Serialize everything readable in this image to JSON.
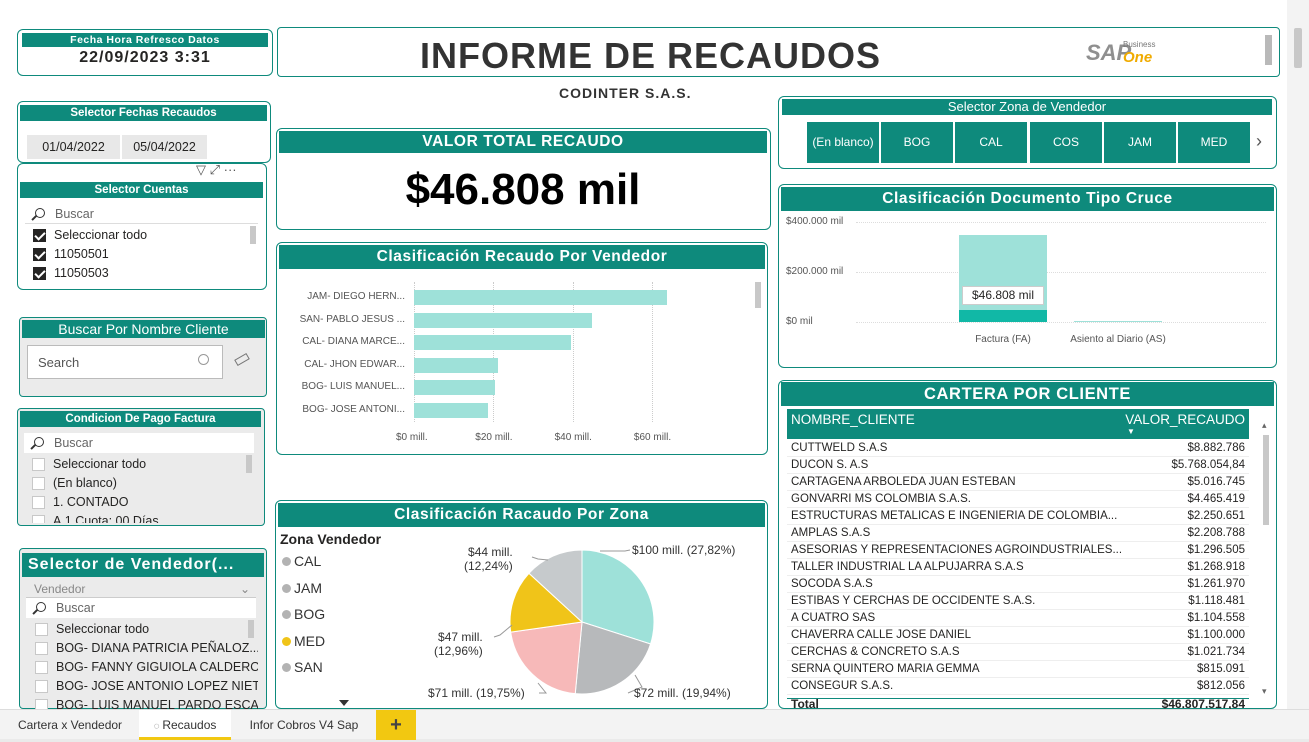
{
  "header": {
    "refresh_label": "Fecha Hora Refresco Datos",
    "refresh_value": "22/09/2023 3:31",
    "title": "INFORME DE RECAUDOS",
    "company": "CODINTER S.A.S.",
    "logo_sap": "SAP",
    "logo_business": "Business",
    "logo_one": "One"
  },
  "date_selector": {
    "title": "Selector Fechas Recaudos",
    "start": "01/04/2022",
    "end": "05/04/2022"
  },
  "accounts": {
    "title": "Selector Cuentas",
    "search": "Buscar",
    "items": [
      {
        "label": "Seleccionar todo",
        "checked": true
      },
      {
        "label": "11050501",
        "checked": true
      },
      {
        "label": "11050503",
        "checked": true
      }
    ]
  },
  "client_search": {
    "title": "Buscar Por  Nombre Cliente",
    "placeholder": "Search"
  },
  "payment_condition": {
    "title": "Condicion De Pago Factura",
    "search": "Buscar",
    "items": [
      "Seleccionar todo",
      "(En blanco)",
      "1. CONTADO",
      "A.1 Cuota: 00 Días"
    ]
  },
  "seller_selector": {
    "title": "Selector  de  Vendedor(...",
    "dropdown": "Vendedor",
    "search": "Buscar",
    "items": [
      "Seleccionar todo",
      "BOG- DIANA PATRICIA PEÑALOZ...",
      "BOG- FANNY GIGUIOLA CALDERO...",
      "BOG- JOSE ANTONIO LOPEZ NIETO",
      "BOG- LUIS MANUEL PARDO ESCA..."
    ]
  },
  "total_card": {
    "title": "VALOR TOTAL RECAUDO",
    "value": "$46.808 mil"
  },
  "seller_chart": {
    "title": "Clasificación Recaudo Por Vendedor",
    "chart_data": {
      "type": "bar",
      "orientation": "horizontal",
      "categories": [
        "JAM- DIEGO HERN...",
        "SAN- PABLO JESUS ...",
        "CAL- DIANA MARCE...",
        "CAL- JHON EDWAR...",
        "BOG- LUIS MANUEL...",
        "BOG- JOSE ANTONI..."
      ],
      "values": [
        63.8,
        45,
        39.5,
        21.3,
        20.3,
        18.7
      ],
      "xticks": [
        "$0 mill.",
        "$20 mill.",
        "$40 mill.",
        "$60 mill."
      ],
      "xlim": [
        0,
        75
      ],
      "color": "#9ee1d9"
    }
  },
  "zone_selector": {
    "title": "Selector  Zona de Vendedor",
    "buttons": [
      "(En blanco)",
      "BOG",
      "CAL",
      "COS",
      "JAM",
      "MED"
    ]
  },
  "doc_chart": {
    "title": "Clasificación Documento Tipo Cruce",
    "chart_data": {
      "type": "bar",
      "categories": [
        "Factura (FA)",
        "Asiento al Diario (AS)"
      ],
      "values": [
        46808,
        0
      ],
      "background_values": [
        350000,
        0
      ],
      "yticks": [
        "$400.000 mil",
        "$200.000 mil",
        "$0 mil"
      ],
      "ylim": [
        0,
        400000
      ],
      "data_label": "$46.808 mil"
    }
  },
  "zone_chart": {
    "title": "Clasificación Racaudo Por Zona",
    "chart_data": {
      "type": "pie",
      "legend_title": "Zona Vendedor",
      "labels": [
        "CAL",
        "JAM",
        "BOG",
        "MED",
        "SAN"
      ],
      "values": [
        100,
        72,
        71,
        47,
        44
      ],
      "percents": [
        "27,82%",
        "19,94%",
        "19,75%",
        "12,96%",
        "12,24%"
      ],
      "colors": [
        "#9ee1d9",
        "#b7b9bb",
        "#f7b9b9",
        "#f0c419",
        "#c6cacc"
      ],
      "data_labels": [
        "$100 mill. (27,82%)",
        "$72 mill. (19,94%)",
        "$71 mill. (19,75%)",
        "$47 mill. (12,96%)",
        "$44 mill. (12,24%)"
      ],
      "legend_colors": [
        "#b3b3b3",
        "#b3b3b3",
        "#b3b3b3",
        "#f0c419",
        "#b3b3b3"
      ]
    }
  },
  "portfolio": {
    "title": "CARTERA POR CLIENTE",
    "columns": [
      "NOMBRE_CLIENTE",
      "VALOR_RECAUDO"
    ],
    "rows": [
      [
        "CUTTWELD S.A.S",
        "$8.882.786"
      ],
      [
        "DUCON S. A.S",
        "$5.768.054,84"
      ],
      [
        "CARTAGENA ARBOLEDA JUAN ESTEBAN",
        "$5.016.745"
      ],
      [
        "GONVARRI MS COLOMBIA S.A.S.",
        "$4.465.419"
      ],
      [
        "ESTRUCTURAS METALICAS E INGENIERIA DE COLOMBIA...",
        "$2.250.651"
      ],
      [
        "AMPLAS S.A.S",
        "$2.208.788"
      ],
      [
        "ASESORIAS Y REPRESENTACIONES AGROINDUSTRIALES...",
        "$1.296.505"
      ],
      [
        "TALLER INDUSTRIAL LA ALPUJARRA S.A.S",
        "$1.268.918"
      ],
      [
        "SOCODA S.A.S",
        "$1.261.970"
      ],
      [
        "ESTIBAS Y CERCHAS DE OCCIDENTE S.A.S.",
        "$1.118.481"
      ],
      [
        "A CUATRO SAS",
        "$1.104.558"
      ],
      [
        "CHAVERRA CALLE JOSE DANIEL",
        "$1.100.000"
      ],
      [
        "CERCHAS & CONCRETO S.A.S",
        "$1.021.734"
      ],
      [
        "SERNA QUINTERO MARIA GEMMA",
        "$815.091"
      ],
      [
        "CONSEGUR S.A.S.",
        "$812.056"
      ]
    ],
    "total_label": "Total",
    "total_value": "$46.807.517,84"
  },
  "tabs": [
    "Cartera x Vendedor",
    "Recaudos",
    "Infor Cobros V4 Sap"
  ],
  "add_tab": "+"
}
